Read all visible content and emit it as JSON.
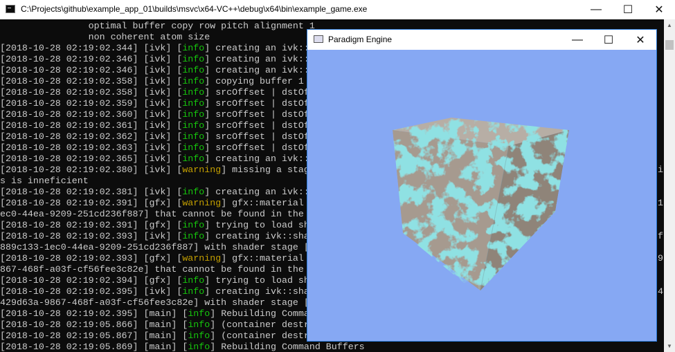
{
  "console_window": {
    "title": "C:\\Projects\\github\\example_app_01\\builds\\msvc\\x64-VC++\\debug\\x64\\bin\\example_game.exe",
    "minimize_glyph": "—",
    "maximize_glyph": "☐",
    "close_glyph": "✕",
    "lines": [
      {
        "pre": "                optimal buffer copy row pitch alignment 1",
        "tag": "",
        "post": ""
      },
      {
        "pre": "                non coherent atom size",
        "tag": "",
        "post": ""
      },
      {
        "pre": "[2018-10-28 02:19:02.344] [ivk] [",
        "tag": "info",
        "post": "] creating an ivk::s"
      },
      {
        "pre": "[2018-10-28 02:19:02.346] [ivk] [",
        "tag": "info",
        "post": "] creating an ivk::s"
      },
      {
        "pre": "[2018-10-28 02:19:02.346] [ivk] [",
        "tag": "info",
        "post": "] creating an ivk::s"
      },
      {
        "pre": "[2018-10-28 02:19:02.358] [ivk] [",
        "tag": "info",
        "post": "] copying buffer 1"
      },
      {
        "pre": "[2018-10-28 02:19:02.358] [ivk] [",
        "tag": "info",
        "post": "] srcOffset | dstOf"
      },
      {
        "pre": "[2018-10-28 02:19:02.359] [ivk] [",
        "tag": "info",
        "post": "] srcOffset | dstOf"
      },
      {
        "pre": "[2018-10-28 02:19:02.360] [ivk] [",
        "tag": "info",
        "post": "] srcOffset | dstOf"
      },
      {
        "pre": "[2018-10-28 02:19:02.361] [ivk] [",
        "tag": "info",
        "post": "] srcOffset | dstOf"
      },
      {
        "pre": "[2018-10-28 02:19:02.362] [ivk] [",
        "tag": "info",
        "post": "] srcOffset | dstOf"
      },
      {
        "pre": "[2018-10-28 02:19:02.363] [ivk] [",
        "tag": "info",
        "post": "] srcOffset | dstOf"
      },
      {
        "pre": "[2018-10-28 02:19:02.365] [ivk] [",
        "tag": "info",
        "post": "] creating an ivk::"
      },
      {
        "pre": "[2018-10-28 02:19:02.380] [ivk] [",
        "tag": "warning",
        "post": "] missing a stag"
      },
      {
        "pre": "s is inneficient",
        "tag": "",
        "post": ""
      },
      {
        "pre": "[2018-10-28 02:19:02.381] [ivk] [",
        "tag": "info",
        "post": "] creating an ivk::"
      },
      {
        "pre": "[2018-10-28 02:19:02.391] [gfx] [",
        "tag": "warning",
        "post": "] gfx::material"
      },
      {
        "pre": "ec0-44ea-9209-251cd236f887] that cannot be found in the",
        "tag": "",
        "post": ""
      },
      {
        "pre": "[2018-10-28 02:19:02.391] [gfx] [",
        "tag": "info",
        "post": "] trying to load sh"
      },
      {
        "pre": "[2018-10-28 02:19:02.393] [ivk] [",
        "tag": "info",
        "post": "] creating ivk::sha"
      },
      {
        "pre": "889c133-1ec0-44ea-9209-251cd236f887] with shader stage [",
        "tag": "",
        "post": ""
      },
      {
        "pre": "[2018-10-28 02:19:02.393] [gfx] [",
        "tag": "warning",
        "post": "] gfx::material"
      },
      {
        "pre": "867-468f-a03f-cf56fee3c82e] that cannot be found in the",
        "tag": "",
        "post": ""
      },
      {
        "pre": "[2018-10-28 02:19:02.394] [gfx] [",
        "tag": "info",
        "post": "] trying to load sh"
      },
      {
        "pre": "[2018-10-28 02:19:02.395] [ivk] [",
        "tag": "info",
        "post": "] creating ivk::sha"
      },
      {
        "pre": "429d63a-9867-468f-a03f-cf56fee3c82e] with shader stage [",
        "tag": "",
        "post": ""
      },
      {
        "pre": "[2018-10-28 02:19:02.395] [main] [",
        "tag": "info",
        "post": "] Rebuilding Comma"
      },
      {
        "pre": "[2018-10-28 02:19:05.866] [main] [",
        "tag": "info",
        "post": "] (container destr"
      },
      {
        "pre": "[2018-10-28 02:19:05.867] [main] [",
        "tag": "info",
        "post": "] (container destr"
      },
      {
        "pre": "[2018-10-28 02:19:05.869] [main] [",
        "tag": "info",
        "post": "] Rebuilding Command Buffers"
      }
    ],
    "right_edge_fragments": [
      {
        "line": 13,
        "text": "i"
      },
      {
        "line": 16,
        "text": "1"
      },
      {
        "line": 19,
        "text": "f"
      },
      {
        "line": 21,
        "text": "9"
      },
      {
        "line": 24,
        "text": "4"
      }
    ]
  },
  "game_window": {
    "title": "Paradigm Engine",
    "minimize_glyph": "—",
    "maximize_glyph": "☐",
    "close_glyph": "✕",
    "background_color": "#86a8f3",
    "scene": "textured-cube"
  },
  "colors": {
    "console_bg": "#0c0c0c",
    "console_text": "#cccccc",
    "info": "#16c60c",
    "warning": "#c4a000"
  }
}
